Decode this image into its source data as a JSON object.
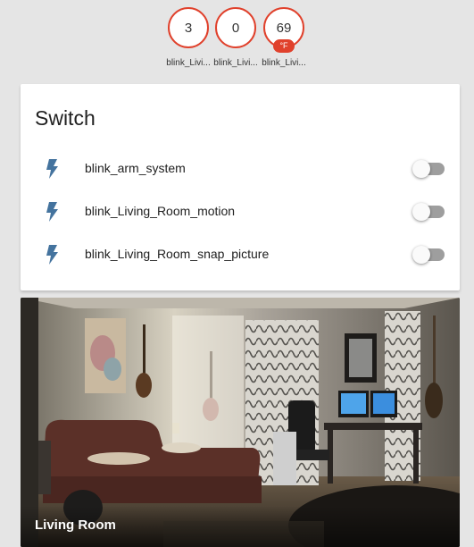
{
  "badges": [
    {
      "value": "3",
      "label": "blink_Livi...",
      "unit": ""
    },
    {
      "value": "0",
      "label": "blink_Livi...",
      "unit": ""
    },
    {
      "value": "69",
      "label": "blink_Livi...",
      "unit": "°F"
    }
  ],
  "switch_card": {
    "title": "Switch",
    "items": [
      {
        "label": "blink_arm_system",
        "icon": "flash-icon",
        "state": "off"
      },
      {
        "label": "blink_Living_Room_motion",
        "icon": "flash-icon",
        "state": "off"
      },
      {
        "label": "blink_Living_Room_snap_picture",
        "icon": "flash-icon",
        "state": "off"
      }
    ]
  },
  "camera": {
    "name": "Living Room"
  },
  "colors": {
    "accent": "#e0412c",
    "icon": "#44739e",
    "background": "#e5e5e5",
    "toggle_off_track": "#9e9e9e"
  }
}
